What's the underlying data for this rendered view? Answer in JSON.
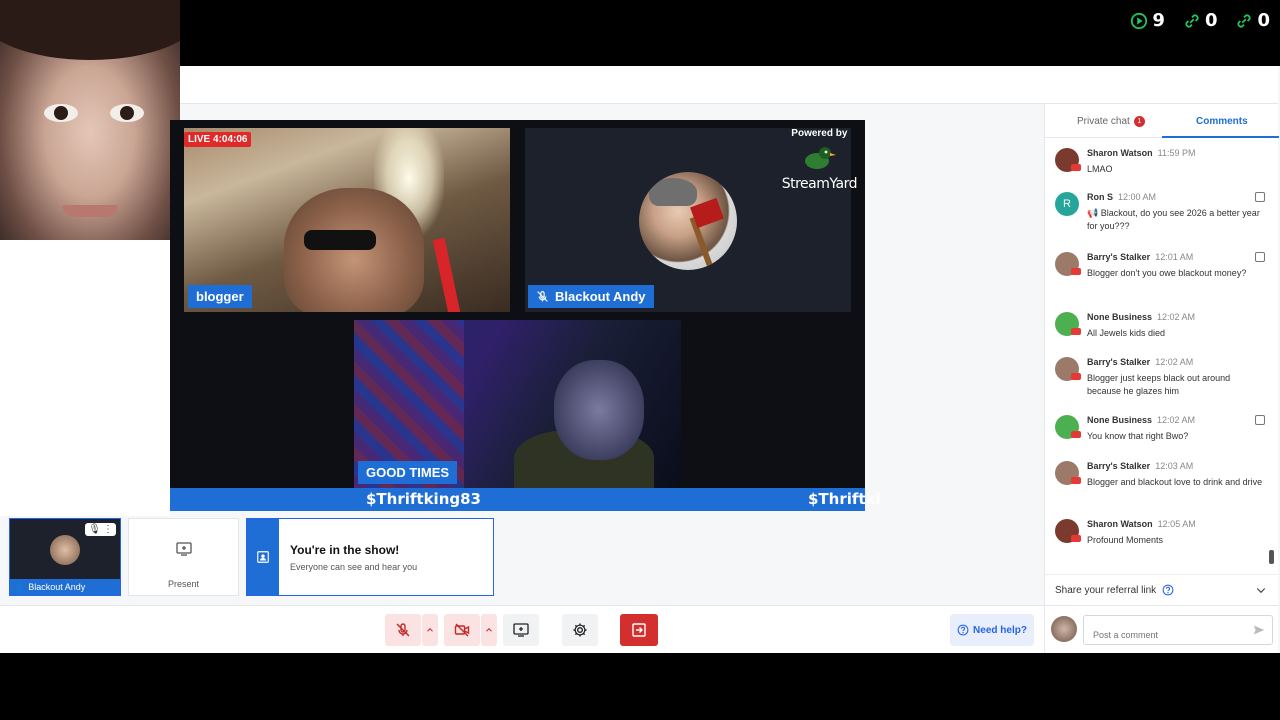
{
  "stats": {
    "views": "9",
    "links_a": "0",
    "links_b": "0"
  },
  "stage": {
    "live_badge": "LIVE 4:04:06",
    "tiles": [
      {
        "name": "blogger"
      },
      {
        "name": "Blackout Andy"
      },
      {
        "name": "GOOD TIMES"
      }
    ],
    "powered_by": "Powered by",
    "brand": "StreamYard",
    "ticker": [
      "$Thriftking83",
      "$Thriftki"
    ]
  },
  "self_tile": {
    "label": "Blackout Andy"
  },
  "present": {
    "label": "Present"
  },
  "inshow": {
    "title": "You're in the show!",
    "subtitle": "Everyone can see and hear you"
  },
  "help": {
    "label": "Need help?"
  },
  "panel": {
    "tabs": {
      "private": "Private chat",
      "private_badge": "1",
      "comments": "Comments"
    },
    "comments": [
      {
        "name": "Sharon Watson",
        "time": "11:59 PM",
        "text": "LMAO",
        "avatar_color": "#7a3b2e"
      },
      {
        "name": "Ron S",
        "time": "12:00 AM",
        "text": "📢 Blackout, do you see 2026 a better year for you???",
        "avatar_color": "#26a69a",
        "avatar_letter": "R"
      },
      {
        "name": "Barry's Stalker",
        "time": "12:01 AM",
        "text": "Blogger don't you owe blackout money?",
        "avatar_color": "#9c7a6a"
      },
      {
        "name": "None Business",
        "time": "12:02 AM",
        "text": "All Jewels kids died",
        "avatar_color": "#4caf50"
      },
      {
        "name": "Barry's Stalker",
        "time": "12:02 AM",
        "text": "Blogger just keeps black out around because he glazes him",
        "avatar_color": "#9c7a6a"
      },
      {
        "name": "None Business",
        "time": "12:02 AM",
        "text": "You know that right Bwo?",
        "avatar_color": "#4caf50"
      },
      {
        "name": "Barry's Stalker",
        "time": "12:03 AM",
        "text": "Blogger and blackout love to drink and drive",
        "avatar_color": "#9c7a6a"
      },
      {
        "name": "Sharon Watson",
        "time": "12:05 AM",
        "text": "Profound Moments",
        "avatar_color": "#7a3b2e"
      }
    ],
    "referral": "Share your referral link",
    "post_placeholder": "Post a comment"
  }
}
